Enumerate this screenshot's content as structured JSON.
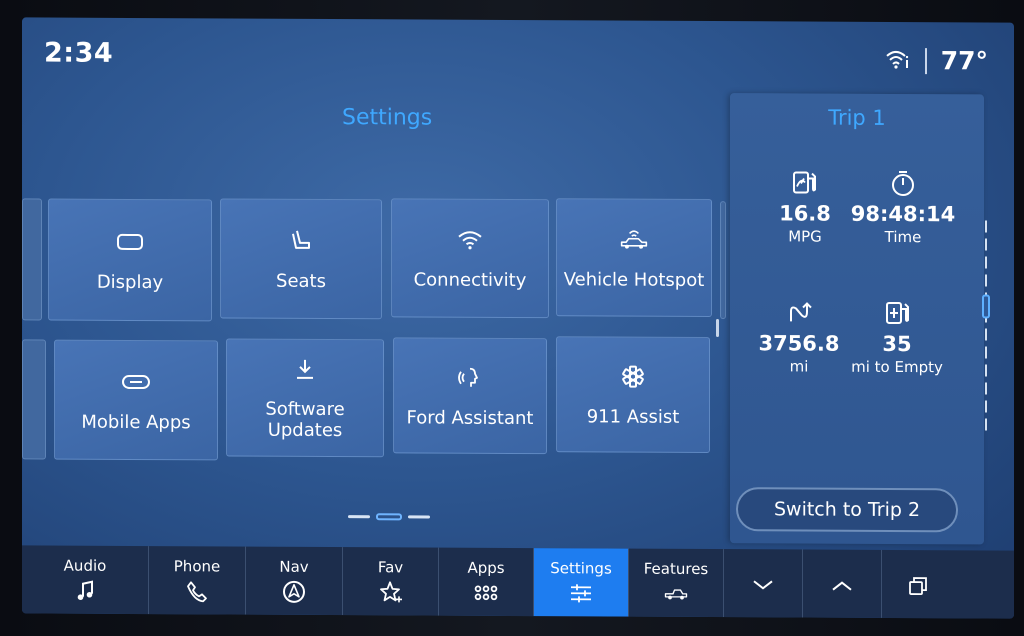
{
  "status_bar": {
    "time": "2:34",
    "temperature": "77°",
    "wifi_icon": "wifi-info-icon"
  },
  "settings": {
    "title": "Settings",
    "tiles": [
      {
        "label": "Display",
        "icon": "display-icon"
      },
      {
        "label": "Seats",
        "icon": "seat-icon"
      },
      {
        "label": "Connectivity",
        "icon": "wifi-icon"
      },
      {
        "label": "Vehicle Hotspot",
        "icon": "vehicle-hotspot-icon"
      },
      {
        "label": "Mobile Apps",
        "icon": "link-icon"
      },
      {
        "label": "Software Updates",
        "icon": "download-icon"
      },
      {
        "label": "Ford Assistant",
        "icon": "voice-assistant-icon"
      },
      {
        "label": "911 Assist",
        "icon": "emergency-icon"
      }
    ],
    "page_indicator": {
      "pages": 3,
      "current": 2
    }
  },
  "trip": {
    "title": "Trip 1",
    "stats": [
      {
        "value": "16.8",
        "unit": "MPG",
        "icon": "fuel-economy-icon"
      },
      {
        "value": "98:48:14",
        "unit": "Time",
        "icon": "stopwatch-icon"
      },
      {
        "value": "3756.8",
        "unit": "mi",
        "icon": "distance-icon"
      },
      {
        "value": "35",
        "unit": "mi to Empty",
        "icon": "fuel-pump-icon"
      }
    ],
    "switch_label": "Switch to Trip 2"
  },
  "nav": [
    {
      "label": "Audio",
      "icon": "music-note-icon"
    },
    {
      "label": "Phone",
      "icon": "phone-icon"
    },
    {
      "label": "Nav",
      "icon": "navigation-icon"
    },
    {
      "label": "Fav",
      "icon": "favorite-star-icon"
    },
    {
      "label": "Apps",
      "icon": "apps-grid-icon"
    },
    {
      "label": "Settings",
      "icon": "sliders-icon",
      "active": true
    },
    {
      "label": "Features",
      "icon": "truck-icon"
    },
    {
      "label": "",
      "icon": "chevron-down-icon"
    },
    {
      "label": "",
      "icon": "chevron-up-icon"
    },
    {
      "label": "",
      "icon": "copy-windows-icon"
    }
  ],
  "colors": {
    "accent": "#3fa8ff",
    "active_tab": "#1e7df0",
    "tile": "#4470b0",
    "background": "#2d5690"
  }
}
